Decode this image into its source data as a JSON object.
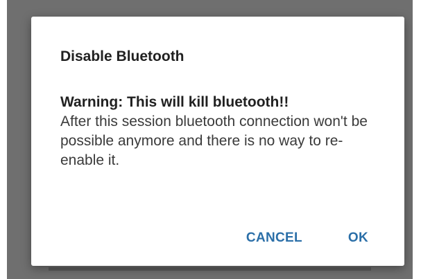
{
  "dialog": {
    "title": "Disable Bluetooth",
    "warning": "Warning: This will kill bluetooth!!",
    "message": "After this session bluetooth connection won't be possible anymore and there is no way to re-enable it.",
    "buttons": {
      "cancel_label": "CANCEL",
      "ok_label": "OK"
    }
  },
  "colors": {
    "accent": "#2b6fa8",
    "scrim": "#6f6f6f",
    "surface": "#ffffff"
  }
}
